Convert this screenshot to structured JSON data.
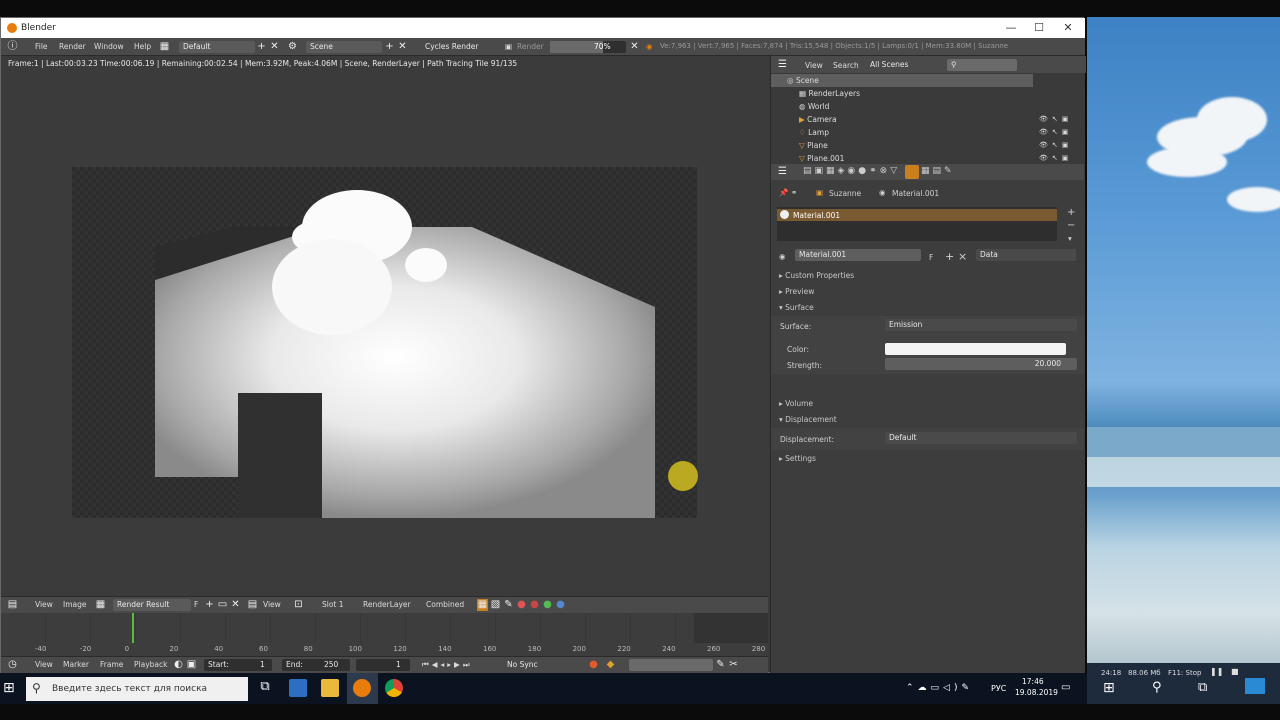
{
  "window": {
    "title": "Blender",
    "minimize": "—",
    "maximize": "☐",
    "close": "✕"
  },
  "info_header": {
    "menu": [
      "File",
      "Render",
      "Window",
      "Help"
    ],
    "layout": "Default",
    "scene": "Scene",
    "engine": "Cycles Render",
    "render_label": "Render",
    "progress": "70%",
    "stats": "Ve:7,963 | Vert:7,965 | Faces:7,874 | Tris:15,548 | Objects:1/5 | Lamps:0/1 | Mem:33.80M | Suzanne"
  },
  "render_status": "Frame:1 | Last:00:03.23 Time:00:06.19 | Remaining:00:02.54 | Mem:3.92M, Peak:4.06M | Scene, RenderLayer | Path Tracing Tile 91/135",
  "image_editor_header": {
    "view": "View",
    "image": "Image",
    "image_name": "Render Result",
    "f": "F",
    "view2": "View",
    "slot": "Slot 1",
    "layer": "RenderLayer",
    "pass": "Combined"
  },
  "timeline": {
    "ticks": [
      "-40",
      "-20",
      "0",
      "20",
      "40",
      "60",
      "80",
      "100",
      "120",
      "140",
      "160",
      "180",
      "200",
      "220",
      "240",
      "260",
      "280"
    ],
    "menu": [
      "View",
      "Marker",
      "Frame",
      "Playback"
    ],
    "start_label": "Start:",
    "start": "1",
    "end_label": "End:",
    "end": "250",
    "current": "1",
    "sync": "No Sync"
  },
  "outliner": {
    "view": "View",
    "search": "Search",
    "filter": "All Scenes",
    "items": [
      "Scene",
      "RenderLayers",
      "World",
      "Camera",
      "Lamp",
      "Plane",
      "Plane.001"
    ]
  },
  "properties": {
    "breadcrumb": [
      "Suzanne",
      "Material.001"
    ],
    "slot": "Material.001",
    "material_field": "Material.001",
    "f": "F",
    "data": "Data",
    "panels": {
      "custom": "Custom Properties",
      "preview": "Preview",
      "surface": "Surface",
      "volume": "Volume",
      "displacement": "Displacement",
      "settings": "Settings"
    },
    "surface_label": "Surface:",
    "surface_value": "Emission",
    "color_label": "Color:",
    "strength_label": "Strength:",
    "strength_value": "20.000",
    "displacement_label": "Displacement:",
    "displacement_value": "Default",
    "emission_color": "#f4f4f4"
  },
  "taskbar": {
    "search_placeholder": "Введите здесь текст для поиска",
    "lang": "РУС",
    "time": "17:46",
    "date": "19.08.2019"
  },
  "obs": {
    "a": "24:18",
    "b": "88.06 Мб",
    "c": "F11: Stop"
  }
}
